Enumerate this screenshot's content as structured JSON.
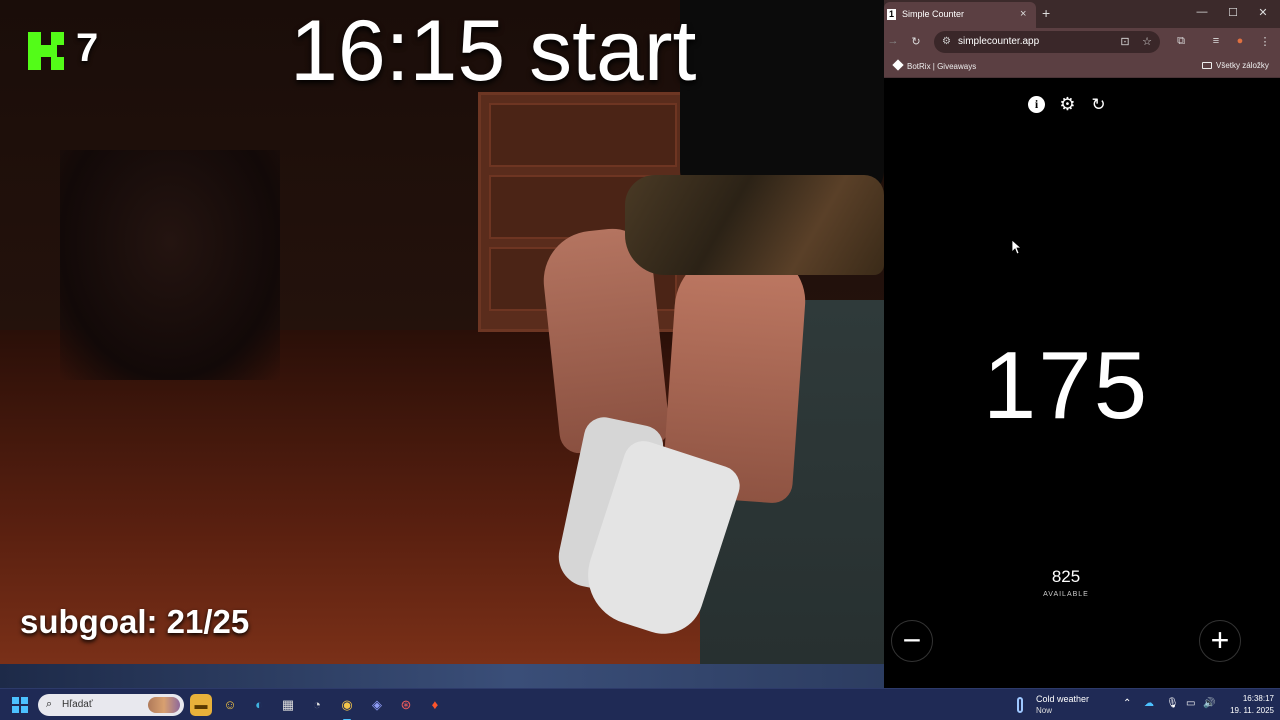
{
  "stream": {
    "viewer_count": "7",
    "start_title": "16:15 start",
    "subgoal": "subgoal: 21/25"
  },
  "browser": {
    "tab_number": "1",
    "tab_title": "Simple Counter",
    "tab_close": "×",
    "new_tab": "+",
    "window_minimize": "—",
    "window_maximize": "☐",
    "window_close": "✕",
    "url": "simplecounter.app",
    "bookmark_1": "BotRix | Giveaways",
    "all_bookmarks": "Všetky záložky"
  },
  "counter_app": {
    "count": "175",
    "available_value": "825",
    "available_label": "AVAILABLE",
    "minus_label": "−",
    "plus_label": "+"
  },
  "taskbar": {
    "search_placeholder": "Hľadať",
    "weather_title": "Cold weather",
    "weather_sub": "Now",
    "time": "16:38:17",
    "date": "19. 11. 2025"
  },
  "colors": {
    "kick_green": "#53fc18",
    "browser_tab": "#5b3f42",
    "taskbar": "#1f2a55"
  }
}
